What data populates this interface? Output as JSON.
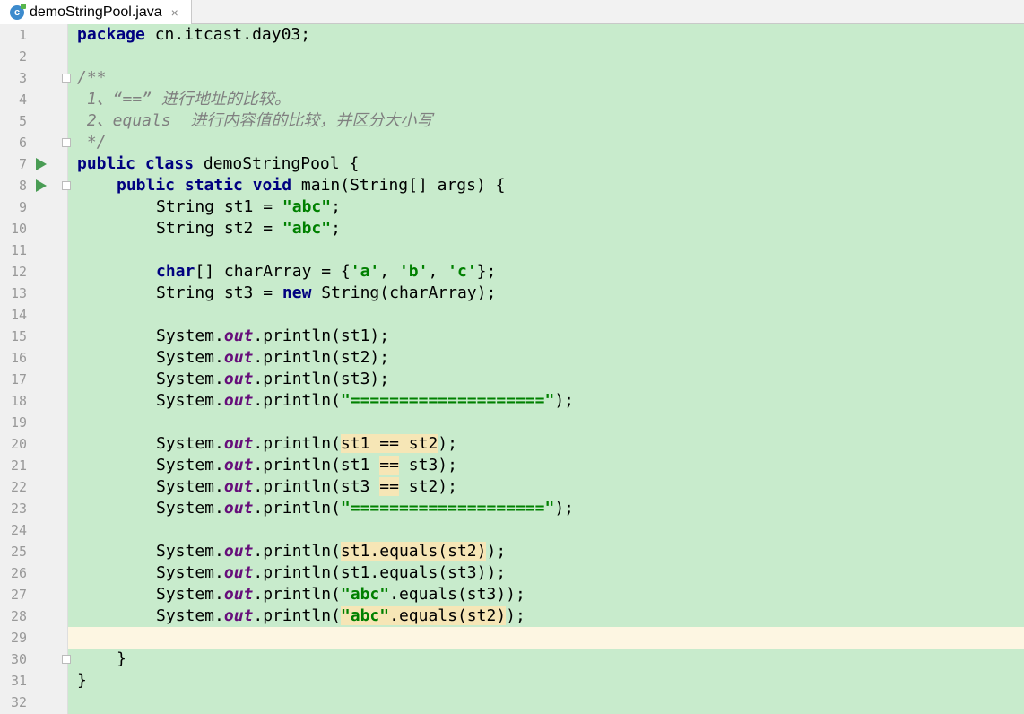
{
  "tab": {
    "title": "demoStringPool.java",
    "close_glyph": "×",
    "icon": "java-class-icon"
  },
  "line_numbers": [
    "1",
    "2",
    "3",
    "4",
    "5",
    "6",
    "7",
    "8",
    "9",
    "10",
    "11",
    "12",
    "13",
    "14",
    "15",
    "16",
    "17",
    "18",
    "19",
    "20",
    "21",
    "22",
    "23",
    "24",
    "25",
    "26",
    "27",
    "28",
    "29",
    "30",
    "31",
    "32"
  ],
  "code": {
    "l1_kw": "package",
    "l1_rest": " cn.itcast.day03;",
    "l3": "/**",
    "l4": " 1、“==” 进行地址的比较。",
    "l5": " 2、equals  进行内容值的比较，并区分大小写",
    "l6": " */",
    "l7_kw": "public class",
    "l7_rest": " demoStringPool {",
    "l8_kw": "public static void",
    "l8_rest": " main(String[] args) {",
    "l9_a": "String st1 = ",
    "l9_s": "\"abc\"",
    "l9_b": ";",
    "l10_a": "String st2 = ",
    "l10_s": "\"abc\"",
    "l10_b": ";",
    "l12_kw": "char",
    "l12_a": "[] charArray = {",
    "l12_s1": "'a'",
    "l12_c1": ", ",
    "l12_s2": "'b'",
    "l12_c2": ", ",
    "l12_s3": "'c'",
    "l12_b": "};",
    "l13_a": "String st3 = ",
    "l13_kw": "new",
    "l13_b": " String(charArray);",
    "sys": "System.",
    "out": "out",
    "l15": ".println(st1);",
    "l16": ".println(st2);",
    "l17": ".println(st3);",
    "l18_a": ".println(",
    "l18_s": "\"====================\"",
    "l18_b": ");",
    "l20_a": ".println(",
    "l20_h": "st1 == st2",
    "l20_b": ");",
    "l21_a": ".println(st1 ",
    "l21_h": "==",
    "l21_b": " st3);",
    "l22_a": ".println(st3 ",
    "l22_h": "==",
    "l22_b": " st2);",
    "l23_a": ".println(",
    "l23_s": "\"====================\"",
    "l23_b": ");",
    "l25_a": ".println(",
    "l25_h": "st1.equals(st2)",
    "l25_b": ");",
    "l26": ".println(st1.equals(st3));",
    "l27_a": ".println(",
    "l27_s": "\"abc\"",
    "l27_b": ".equals(st3));",
    "l28_a": ".println(",
    "l28_s": "\"abc\"",
    "l28_h": ".equals(st2)",
    "l28_b": ");",
    "l30": "}",
    "l31": "}"
  },
  "colors": {
    "editor_bg": "#c8ebcc",
    "current_line": "#fdf6e2",
    "keyword": "#000080",
    "string": "#008000",
    "static_field": "#660e7a",
    "comment": "#808080",
    "highlight": "#f6e6b6"
  }
}
